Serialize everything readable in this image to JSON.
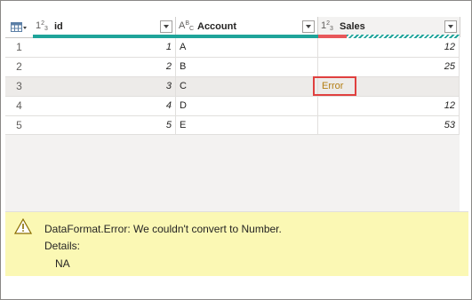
{
  "grid": {
    "columns": [
      {
        "type_icon": "integer-type-icon",
        "type_main": "1",
        "type_sup": "2",
        "type_sub": "3",
        "title": "id",
        "quality": "valid"
      },
      {
        "type_icon": "text-type-icon",
        "type_main": "A",
        "type_sup": "B",
        "type_sub": "C",
        "title": "Account",
        "quality": "valid"
      },
      {
        "type_icon": "integer-type-icon",
        "type_main": "1",
        "type_sup": "2",
        "type_sub": "3",
        "title": "Sales",
        "quality": "error-partial"
      }
    ],
    "rows": [
      {
        "num": "1",
        "id": "1",
        "account": "A",
        "sales": "12",
        "sales_is_error": false
      },
      {
        "num": "2",
        "id": "2",
        "account": "B",
        "sales": "25",
        "sales_is_error": false
      },
      {
        "num": "3",
        "id": "3",
        "account": "C",
        "sales": "Error",
        "sales_is_error": true
      },
      {
        "num": "4",
        "id": "4",
        "account": "D",
        "sales": "12",
        "sales_is_error": false
      },
      {
        "num": "5",
        "id": "5",
        "account": "E",
        "sales": "53",
        "sales_is_error": false
      }
    ],
    "selected_row": 3
  },
  "error_panel": {
    "icon": "warning-icon",
    "message": "DataFormat.Error: We couldn't convert to Number.",
    "details_label": "Details:",
    "details_value": "NA"
  },
  "colors": {
    "quality_valid": "#1fa49a",
    "quality_error": "#e8575a",
    "error_text": "#b37d12",
    "highlight": "#e0403f",
    "panel_bg": "#fbf8b4"
  }
}
